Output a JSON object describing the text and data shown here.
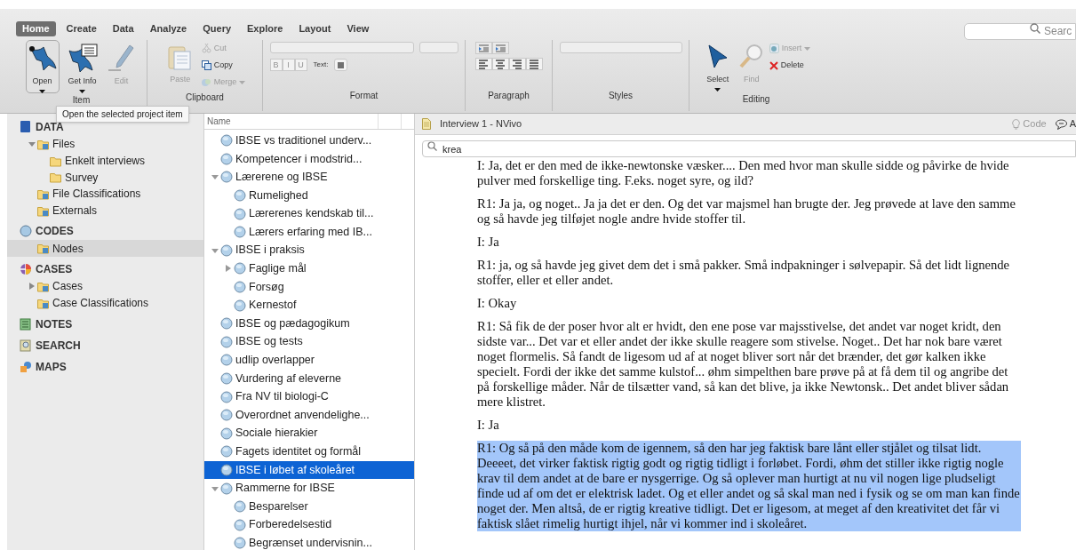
{
  "ribbon": {
    "tabs": [
      {
        "label": "Home",
        "selected": true
      },
      {
        "label": "Create",
        "selected": false
      },
      {
        "label": "Data",
        "selected": false
      },
      {
        "label": "Analyze",
        "selected": false
      },
      {
        "label": "Query",
        "selected": false
      },
      {
        "label": "Explore",
        "selected": false
      },
      {
        "label": "Layout",
        "selected": false
      },
      {
        "label": "View",
        "selected": false
      }
    ],
    "search": {
      "placeholder": "Searc"
    },
    "groups": [
      {
        "kind": "item",
        "label": "Item",
        "buttons": [
          {
            "label": "Open",
            "disabled": false,
            "selected": true
          },
          {
            "label": "Get Info",
            "disabled": false,
            "selected": false
          },
          {
            "label": "Edit",
            "disabled": true,
            "selected": false
          }
        ]
      },
      {
        "kind": "clipboard",
        "label": "Clipboard",
        "buttons": [
          {
            "label": "Paste",
            "disabled": true
          },
          {
            "label": "Cut",
            "disabled": true
          },
          {
            "label": "Copy",
            "disabled": false
          },
          {
            "label": "Merge",
            "disabled": true
          }
        ]
      },
      {
        "kind": "format",
        "label": "Format",
        "styles": [
          {
            "label": "B",
            "disabled": true
          },
          {
            "label": "I",
            "disabled": true
          },
          {
            "label": "U",
            "disabled": true
          }
        ],
        "text_label": "Text:"
      },
      {
        "kind": "paragraph",
        "label": "Paragraph"
      },
      {
        "kind": "styles",
        "label": "Styles"
      },
      {
        "kind": "editing",
        "label": "Editing",
        "buttons": [
          {
            "label": "Select",
            "disabled": false
          },
          {
            "label": "Find",
            "disabled": true
          },
          {
            "label": "Insert",
            "disabled": true
          },
          {
            "label": "Delete",
            "disabled": false
          }
        ]
      }
    ]
  },
  "tooltip": "Open the selected project item",
  "sidebar": [
    {
      "label": "DATA",
      "items": [
        {
          "label": "Files",
          "selected": false,
          "expanded": true,
          "children": [
            {
              "label": "Enkelt interviews",
              "selected": false
            },
            {
              "label": "Survey",
              "selected": false
            }
          ]
        },
        {
          "label": "File Classifications",
          "selected": false
        },
        {
          "label": "Externals",
          "selected": false
        }
      ]
    },
    {
      "label": "CODES",
      "items": [
        {
          "label": "Nodes",
          "selected": true
        }
      ]
    },
    {
      "label": "CASES",
      "items": [
        {
          "label": "Cases",
          "selected": false,
          "expanded": false
        },
        {
          "label": "Case Classifications",
          "selected": false
        }
      ]
    },
    {
      "label": "NOTES"
    },
    {
      "label": "SEARCH"
    },
    {
      "label": "MAPS"
    }
  ],
  "nodes": {
    "column": "Name",
    "items": [
      {
        "label": "IBSE vs traditionel underv...",
        "selected": false
      },
      {
        "label": "Kompetencer i modstrid...",
        "selected": false
      },
      {
        "label": "Lærerene og IBSE",
        "selected": false,
        "expanded": true,
        "children": [
          {
            "label": "Rumelighed",
            "selected": false
          },
          {
            "label": "Lærerenes kendskab til...",
            "selected": false
          },
          {
            "label": "Lærers erfaring med IB...",
            "selected": false
          }
        ]
      },
      {
        "label": "IBSE i praksis",
        "selected": false,
        "expanded": true,
        "children": [
          {
            "label": "Faglige mål",
            "selected": false,
            "expanded": false
          },
          {
            "label": "Forsøg",
            "selected": false
          },
          {
            "label": "Kernestof",
            "selected": false
          }
        ]
      },
      {
        "label": "IBSE og pædagogikum",
        "selected": false
      },
      {
        "label": "IBSE og tests",
        "selected": false
      },
      {
        "label": "udlip overlapper",
        "selected": false
      },
      {
        "label": "Vurdering af eleverne",
        "selected": false
      },
      {
        "label": "Fra NV til biologi-C",
        "selected": false
      },
      {
        "label": "Overordnet anvendelighe...",
        "selected": false
      },
      {
        "label": "Sociale hierakier",
        "selected": false
      },
      {
        "label": "Fagets identitet og formål",
        "selected": false
      },
      {
        "label": "IBSE i løbet af skoleåret",
        "selected": true
      },
      {
        "label": "Rammerne for IBSE",
        "selected": false,
        "expanded": true,
        "children": [
          {
            "label": "Besparelser",
            "selected": false
          },
          {
            "label": "Forberedelsestid",
            "selected": false
          },
          {
            "label": "Begrænset undervisnin...",
            "selected": false
          }
        ]
      }
    ]
  },
  "document": {
    "title": "Interview 1 - NVivo",
    "code_button": "Code",
    "cut_button": "A",
    "search": {
      "value": "krea"
    },
    "paragraphs": [
      {
        "text": "I: Ja, det er den med de ikke-newtonske væsker.... Den med hvor man skulle sidde og påvirke de hvide pulver med forskellige ting. F.eks. noget syre, og ild?",
        "highlighted": false
      },
      {
        "text": "R1: Ja ja, og noget.. Ja ja det er den. Og det var majsmel han brugte der. Jeg prøvede at lave den samme og så havde jeg tilføjet nogle andre hvide stoffer til.",
        "highlighted": false
      },
      {
        "text": "I: Ja",
        "highlighted": false
      },
      {
        "text": "R1: ja, og så havde jeg givet dem det i små pakker. Små indpakninger i sølvepapir. Så det lidt lignende stoffer, eller et eller andet.",
        "highlighted": false
      },
      {
        "text": "I: Okay",
        "highlighted": false
      },
      {
        "text": "R1: Så fik de der poser hvor alt er hvidt, den ene pose var majsstivelse, det andet var noget kridt, den sidste var... Det var et eller andet der ikke skulle reagere som stivelse. Noget.. Det har nok bare været noget flormelis. Så fandt de ligesom ud af at noget bliver sort når det brænder, det gør kalken ikke specielt. Fordi der ikke det samme kulstof... øhm simpelthen bare prøve på at få dem til og angribe det på forskellige måder. Når de tilsætter vand, så kan det blive, ja ikke Newtonsk.. Det andet bliver sådan mere klistret.",
        "highlighted": false
      },
      {
        "text": "I: Ja",
        "highlighted": false
      },
      {
        "text": "R1: Og så på den måde kom de igennem, så den har jeg faktisk bare lånt eller stjålet og tilsat lidt. Deeeet, det virker faktisk rigtig godt og rigtig tidligt i forløbet. Fordi, øhm det stiller ikke rigtig nogle krav til dem andet at de bare er nysgerrige. Og så oplever man hurtigt at nu vil nogen lige pludseligt finde ud af om det er elektrisk ladet. Og et eller andet og så skal man ned i fysik og se om man kan finde noget der. Men altså, de er rigtig kreative tidligt. Det er ligesom, at meget af den kreativitet det får vi faktisk slået rimelig hurtigt ihjel, når vi kommer ind i skoleåret.",
        "highlighted": true
      }
    ]
  }
}
